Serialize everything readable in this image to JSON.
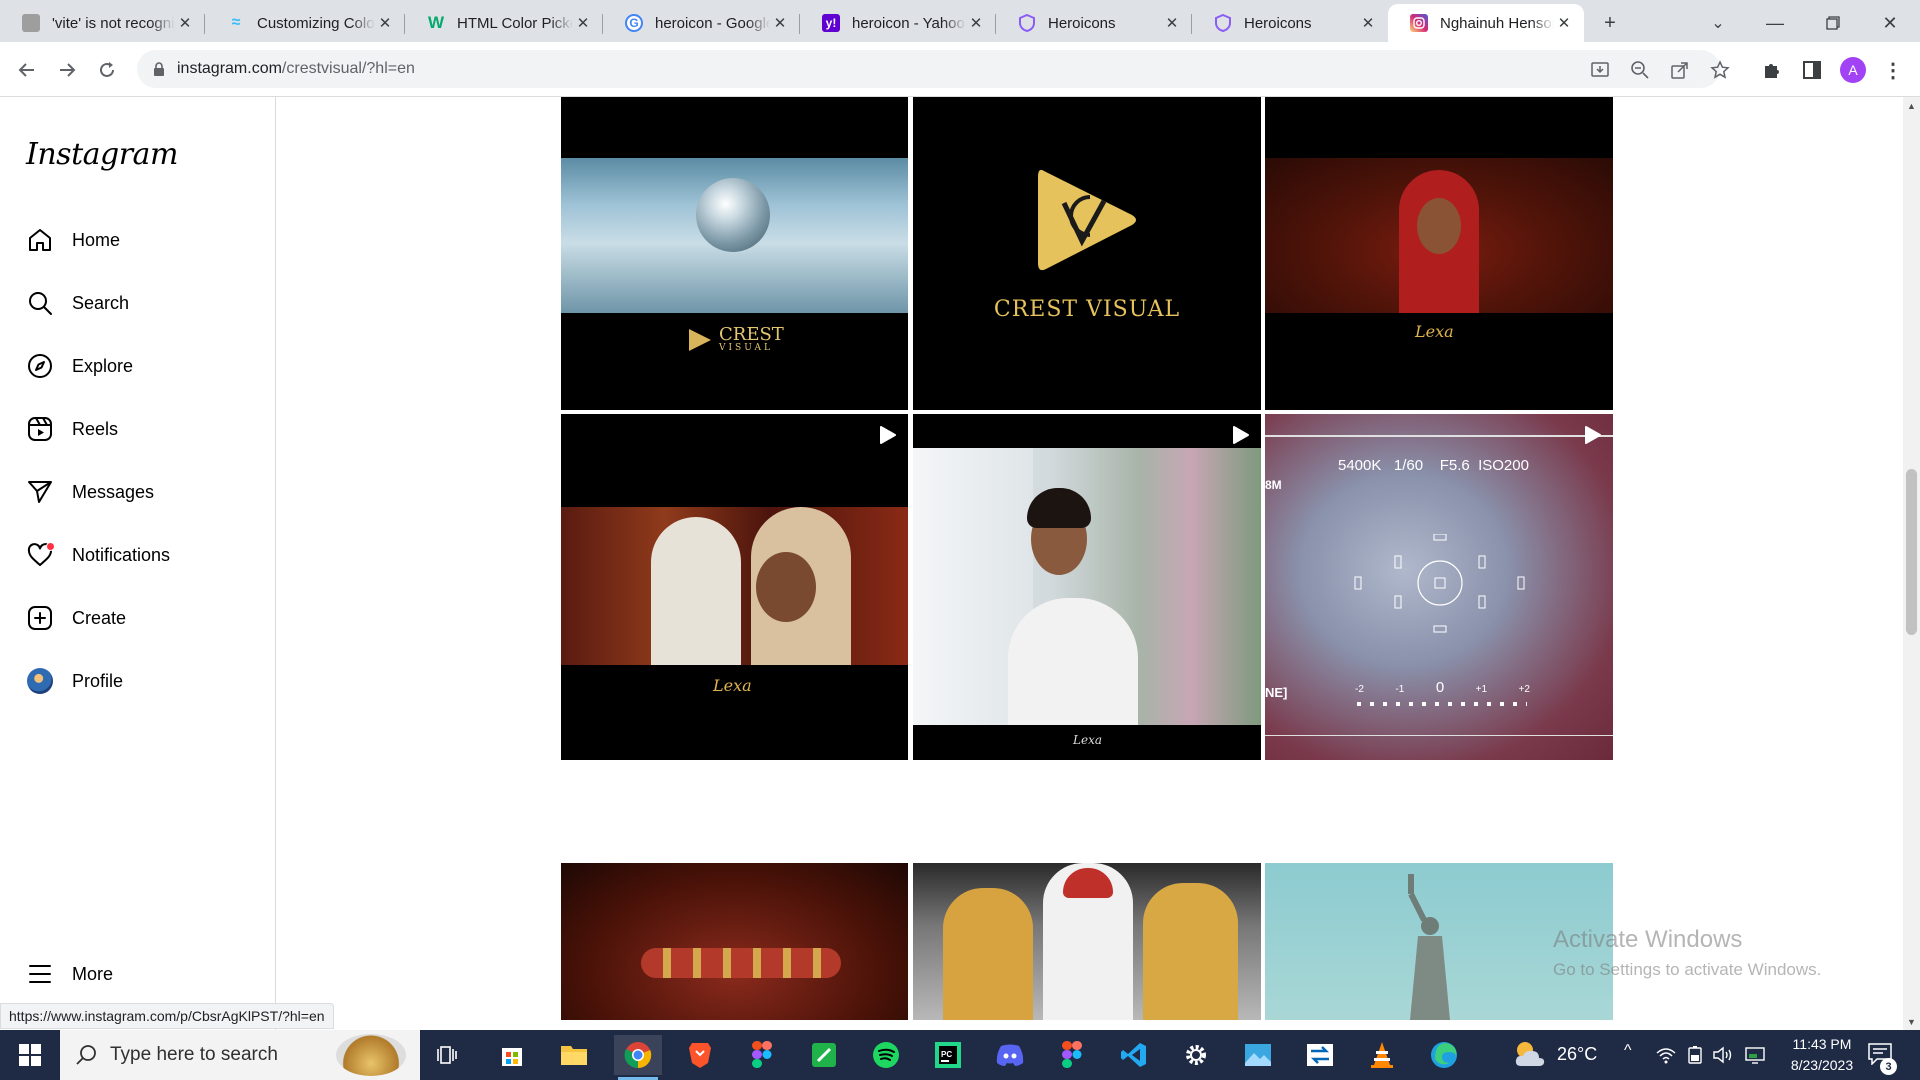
{
  "browser": {
    "tabs": [
      {
        "title": "'vite' is not recognized",
        "favicon": "vite-icon",
        "color": "#8a8a8a"
      },
      {
        "title": "Customizing Colors",
        "favicon": "tailwind-icon",
        "color": "#38bdf8"
      },
      {
        "title": "HTML Color Picker",
        "favicon": "w3schools-icon",
        "color": "#04aa6d"
      },
      {
        "title": "heroicon - Google Search",
        "favicon": "google-icon",
        "color": "#4285f4"
      },
      {
        "title": "heroicon - Yahoo Search",
        "favicon": "yahoo-icon",
        "color": "#6001d2"
      },
      {
        "title": "Heroicons",
        "favicon": "heroicons-icon",
        "color": "#8b5cf6"
      },
      {
        "title": "Heroicons",
        "favicon": "heroicons-icon",
        "color": "#8b5cf6"
      },
      {
        "title": "Nghainuh Henson",
        "favicon": "instagram-icon",
        "color": "#e1306c"
      }
    ],
    "url_host": "instagram.com",
    "url_path": "/crestvisual/?hl=en",
    "status_url": "https://www.instagram.com/p/CbsrAgKlPST/?hl=en",
    "profile_initial": "A"
  },
  "instagram": {
    "logo": "Instagram",
    "nav": [
      {
        "label": "Home",
        "icon": "home-icon"
      },
      {
        "label": "Search",
        "icon": "search-icon"
      },
      {
        "label": "Explore",
        "icon": "compass-icon"
      },
      {
        "label": "Reels",
        "icon": "reels-icon"
      },
      {
        "label": "Messages",
        "icon": "send-icon"
      },
      {
        "label": "Notifications",
        "icon": "heart-icon"
      },
      {
        "label": "Create",
        "icon": "plus-square-icon"
      },
      {
        "label": "Profile",
        "icon": "avatar"
      }
    ],
    "more_label": "More",
    "tiles": {
      "brand_small_1": "CREST",
      "brand_small_2": "VISUAL",
      "brand_large": "CREST VISUAL",
      "signature": "Lexa",
      "cam_settings": "5400K   1/60    F5.6  ISO200",
      "cam_left_top": "8M",
      "cam_left_bottom": "NE]",
      "cam_scale": [
        "-2",
        "-1",
        "0",
        "+1",
        "+2"
      ]
    }
  },
  "watermark": {
    "line1": "Activate Windows",
    "line2": "Go to Settings to activate Windows."
  },
  "taskbar": {
    "search_placeholder": "Type here to search",
    "weather": "26°C",
    "time": "11:43 PM",
    "date": "8/23/2023",
    "notifications": "3"
  }
}
